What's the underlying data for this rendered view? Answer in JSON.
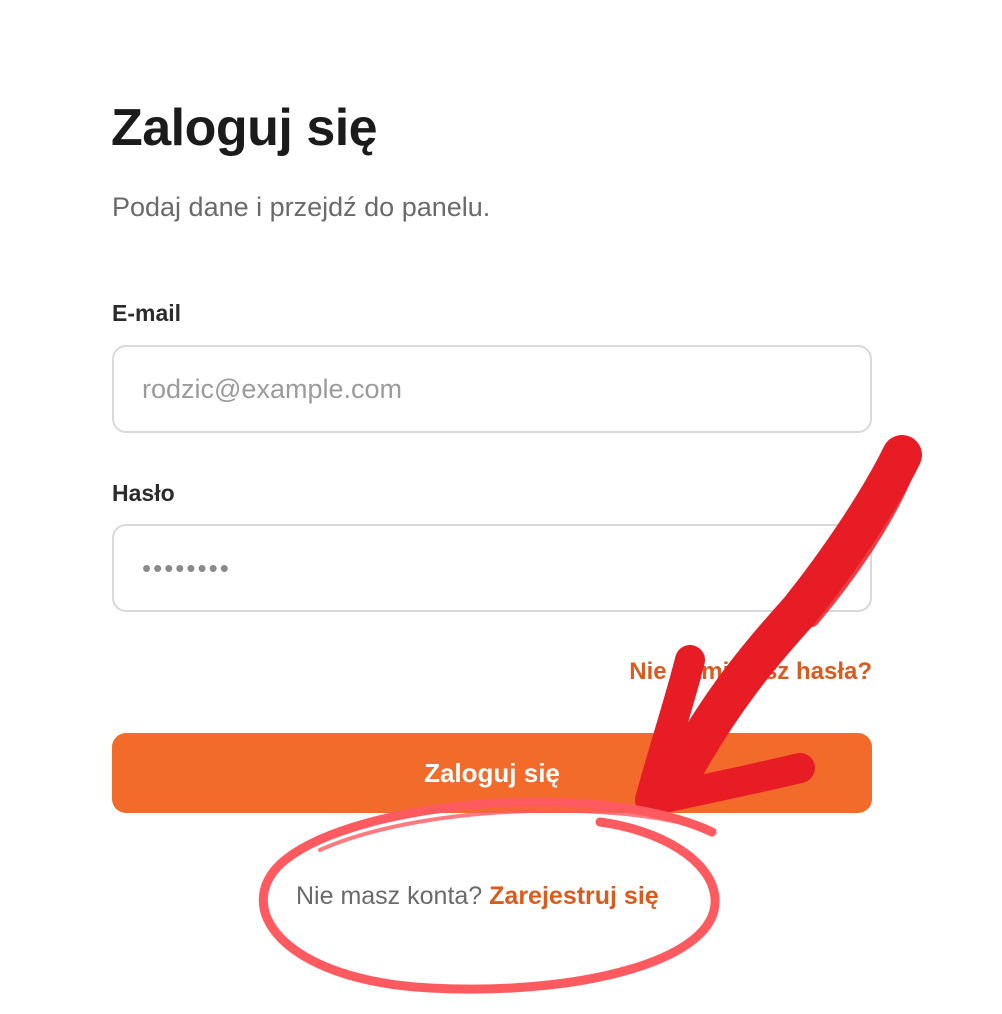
{
  "login": {
    "title": "Zaloguj się",
    "subtitle": "Podaj dane i przejdź do panelu.",
    "email": {
      "label": "E-mail",
      "placeholder": "rodzic@example.com",
      "value": ""
    },
    "password": {
      "label": "Hasło",
      "value": "••••••••"
    },
    "forgot_password": "Nie pamiętasz hasła?",
    "submit_label": "Zaloguj się",
    "register_prompt": "Nie masz konta?",
    "register_link": "Zarejestruj się"
  },
  "annotation": {
    "arrow_color": "#e81c24",
    "circle_color": "#ff5a60",
    "accent_color": "#f26b2a",
    "link_color": "#d95b1d",
    "icon": "hand-drawn-arrow-icon"
  }
}
